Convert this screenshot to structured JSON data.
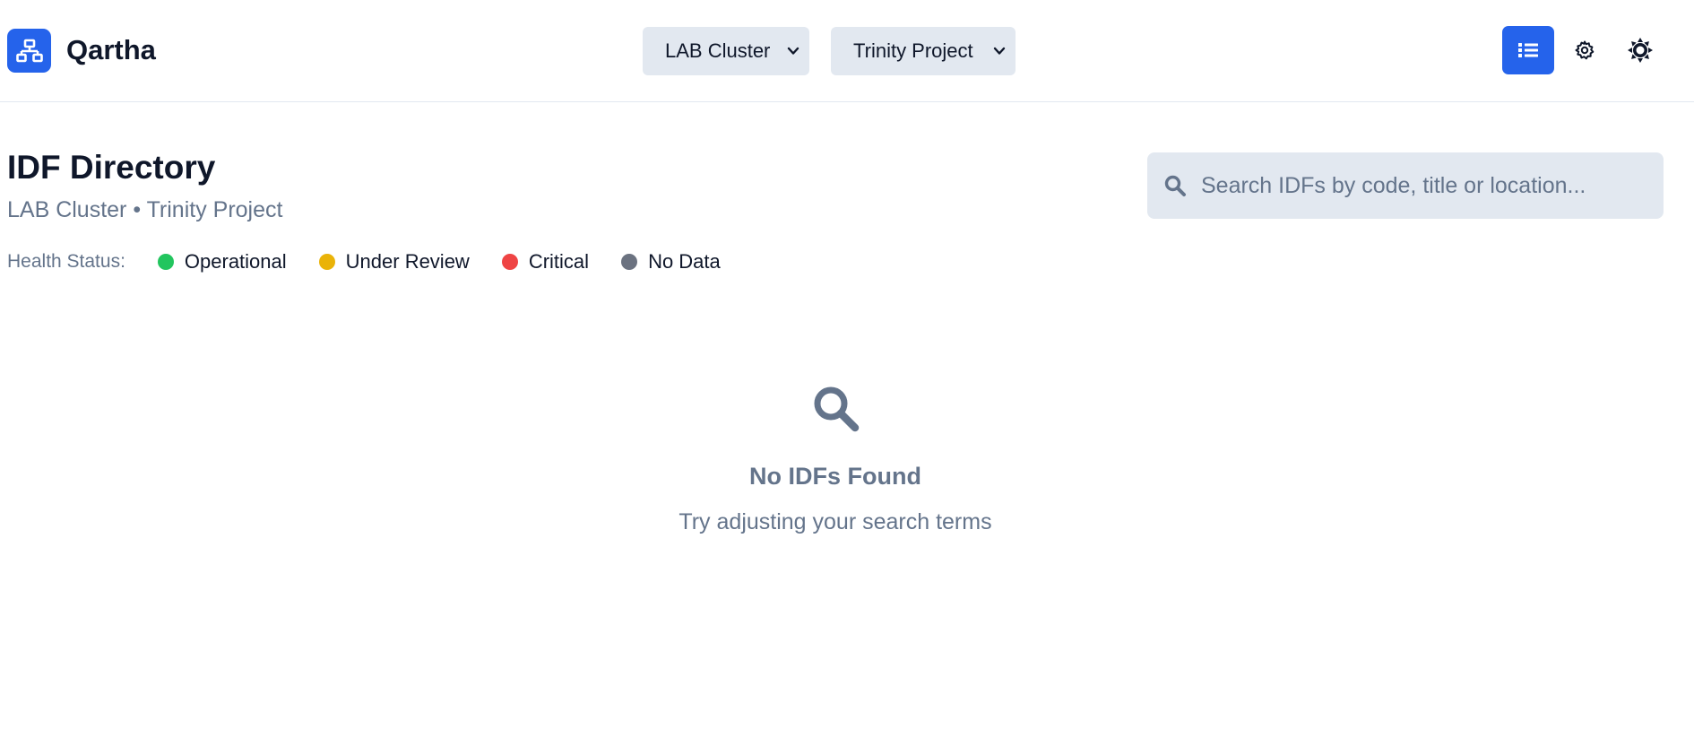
{
  "app": {
    "name": "Qartha",
    "logo_icon": "network-icon",
    "accent": "#2563eb"
  },
  "header": {
    "cluster_select": {
      "value": "LAB Cluster",
      "icon": "chevron-down-icon"
    },
    "project_select": {
      "value": "Trinity Project",
      "icon": "chevron-down-icon"
    },
    "actions": {
      "list_view_icon": "list-icon",
      "settings_icon": "gear-icon",
      "theme_icon": "sun-icon"
    }
  },
  "page": {
    "title": "IDF Directory",
    "subtitle": "LAB Cluster • Trinity Project"
  },
  "health": {
    "label": "Health Status:",
    "statuses": [
      {
        "label": "Operational",
        "color": "#22c55e"
      },
      {
        "label": "Under Review",
        "color": "#eab308"
      },
      {
        "label": "Critical",
        "color": "#ef4444"
      },
      {
        "label": "No Data",
        "color": "#6b7280"
      }
    ]
  },
  "search": {
    "placeholder": "Search IDFs by code, title or location...",
    "value": "",
    "icon": "search-icon"
  },
  "empty_state": {
    "icon": "search-icon",
    "title": "No IDFs Found",
    "description": "Try adjusting your search terms"
  }
}
